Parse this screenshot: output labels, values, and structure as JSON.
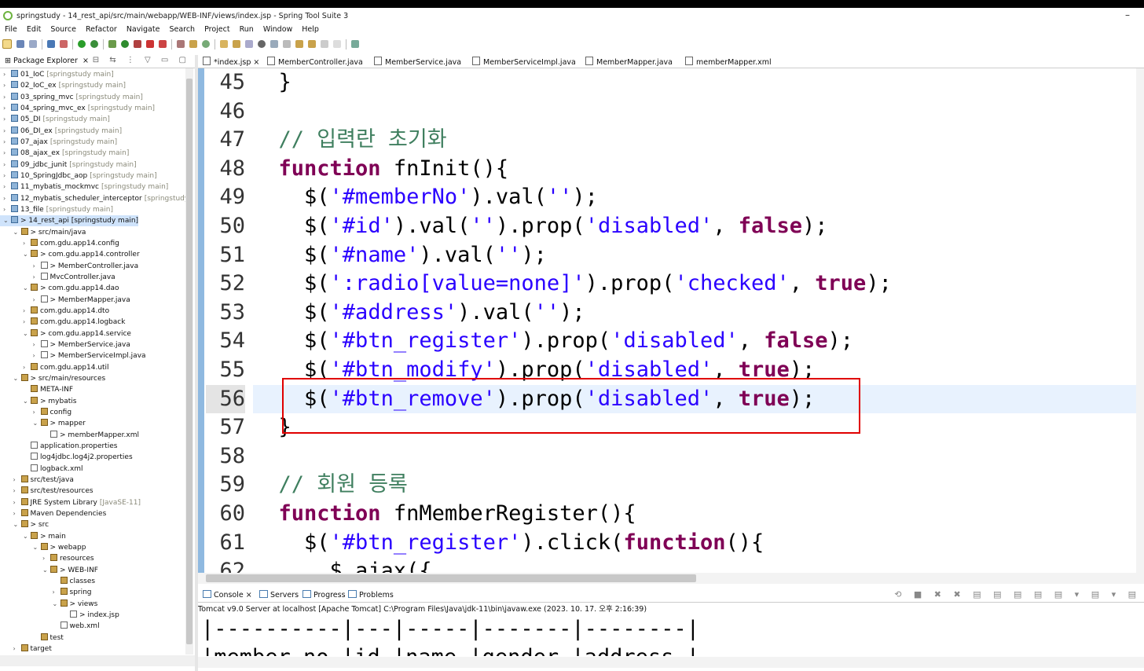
{
  "window": {
    "title": "springstudy - 14_rest_api/src/main/webapp/WEB-INF/views/index.jsp - Spring Tool Suite 3",
    "minimize": "–"
  },
  "menu": [
    "File",
    "Edit",
    "Source",
    "Refactor",
    "Navigate",
    "Search",
    "Project",
    "Run",
    "Window",
    "Help"
  ],
  "package_explorer": {
    "tab_label": "Package Explorer",
    "tab_close": "×",
    "tools": "⊟ ⇆ ⋮ ▽ ▭ ▢",
    "rows": [
      {
        "tw": "›",
        "icon": "proj",
        "label": "01_IoC",
        "meta": "[springstudy main]"
      },
      {
        "tw": "›",
        "icon": "proj",
        "label": "02_IoC_ex",
        "meta": "[springstudy main]"
      },
      {
        "tw": "›",
        "icon": "proj",
        "label": "03_spring_mvc",
        "meta": "[springstudy main]"
      },
      {
        "tw": "›",
        "icon": "proj",
        "label": "04_spring_mvc_ex",
        "meta": "[springstudy main]"
      },
      {
        "tw": "›",
        "icon": "proj",
        "label": "05_DI",
        "meta": "[springstudy main]"
      },
      {
        "tw": "›",
        "icon": "proj",
        "label": "06_DI_ex",
        "meta": "[springstudy main]"
      },
      {
        "tw": "›",
        "icon": "proj",
        "label": "07_ajax",
        "meta": "[springstudy main]"
      },
      {
        "tw": "›",
        "icon": "proj",
        "label": "08_ajax_ex",
        "meta": "[springstudy main]"
      },
      {
        "tw": "›",
        "icon": "proj",
        "label": "09_jdbc_junit",
        "meta": "[springstudy main]"
      },
      {
        "tw": "›",
        "icon": "proj",
        "label": "10_SpringJdbc_aop",
        "meta": "[springstudy main]"
      },
      {
        "tw": "›",
        "icon": "proj",
        "label": "11_mybatis_mockmvc",
        "meta": "[springstudy main]"
      },
      {
        "tw": "›",
        "icon": "proj",
        "label": "12_mybatis_scheduler_interceptor",
        "meta": "[springstudy"
      },
      {
        "tw": "›",
        "icon": "proj",
        "label": "13_file",
        "meta": "[springstudy main]"
      },
      {
        "tw": "⌄",
        "icon": "proj",
        "label": "> 14_rest_api [springstudy main]",
        "meta": "",
        "sel": true
      },
      {
        "tw": "⌄",
        "icon": "pkg",
        "label": "> src/main/java",
        "meta": "",
        "indent": 1
      },
      {
        "tw": "›",
        "icon": "pkg",
        "label": "com.gdu.app14.config",
        "meta": "",
        "indent": 2
      },
      {
        "tw": "⌄",
        "icon": "pkg",
        "label": "> com.gdu.app14.controller",
        "meta": "",
        "indent": 2
      },
      {
        "tw": "›",
        "icon": "file",
        "label": "> MemberController.java",
        "meta": "",
        "indent": 3
      },
      {
        "tw": "›",
        "icon": "file",
        "label": "MvcController.java",
        "meta": "",
        "indent": 3
      },
      {
        "tw": "⌄",
        "icon": "pkg",
        "label": "> com.gdu.app14.dao",
        "meta": "",
        "indent": 2
      },
      {
        "tw": "›",
        "icon": "file",
        "label": "> MemberMapper.java",
        "meta": "",
        "indent": 3
      },
      {
        "tw": "›",
        "icon": "pkg",
        "label": "com.gdu.app14.dto",
        "meta": "",
        "indent": 2
      },
      {
        "tw": "›",
        "icon": "pkg",
        "label": "com.gdu.app14.logback",
        "meta": "",
        "indent": 2
      },
      {
        "tw": "⌄",
        "icon": "pkg",
        "label": "> com.gdu.app14.service",
        "meta": "",
        "indent": 2
      },
      {
        "tw": "›",
        "icon": "file",
        "label": "> MemberService.java",
        "meta": "",
        "indent": 3
      },
      {
        "tw": "›",
        "icon": "file",
        "label": "> MemberServiceImpl.java",
        "meta": "",
        "indent": 3
      },
      {
        "tw": "›",
        "icon": "pkg",
        "label": "com.gdu.app14.util",
        "meta": "",
        "indent": 2
      },
      {
        "tw": "⌄",
        "icon": "pkg",
        "label": "> src/main/resources",
        "meta": "",
        "indent": 1
      },
      {
        "tw": "",
        "icon": "pkg",
        "label": "META-INF",
        "meta": "",
        "indent": 2
      },
      {
        "tw": "⌄",
        "icon": "pkg",
        "label": "> mybatis",
        "meta": "",
        "indent": 2
      },
      {
        "tw": "›",
        "icon": "pkg",
        "label": "config",
        "meta": "",
        "indent": 3
      },
      {
        "tw": "⌄",
        "icon": "pkg",
        "label": "> mapper",
        "meta": "",
        "indent": 3
      },
      {
        "tw": "",
        "icon": "file",
        "label": "> memberMapper.xml",
        "meta": "",
        "indent": 4
      },
      {
        "tw": "",
        "icon": "file",
        "label": "application.properties",
        "meta": "",
        "indent": 2
      },
      {
        "tw": "",
        "icon": "file",
        "label": "log4jdbc.log4j2.properties",
        "meta": "",
        "indent": 2
      },
      {
        "tw": "",
        "icon": "file",
        "label": "logback.xml",
        "meta": "",
        "indent": 2
      },
      {
        "tw": "›",
        "icon": "pkg",
        "label": "src/test/java",
        "meta": "",
        "indent": 1
      },
      {
        "tw": "›",
        "icon": "pkg",
        "label": "src/test/resources",
        "meta": "",
        "indent": 1
      },
      {
        "tw": "›",
        "icon": "pkg",
        "label": "JRE System Library",
        "meta": "[JavaSE-11]",
        "indent": 1
      },
      {
        "tw": "›",
        "icon": "pkg",
        "label": "Maven Dependencies",
        "meta": "",
        "indent": 1
      },
      {
        "tw": "⌄",
        "icon": "pkg",
        "label": "> src",
        "meta": "",
        "indent": 1
      },
      {
        "tw": "⌄",
        "icon": "pkg",
        "label": "> main",
        "meta": "",
        "indent": 2
      },
      {
        "tw": "⌄",
        "icon": "pkg",
        "label": "> webapp",
        "meta": "",
        "indent": 3
      },
      {
        "tw": "›",
        "icon": "pkg",
        "label": "resources",
        "meta": "",
        "indent": 4
      },
      {
        "tw": "⌄",
        "icon": "pkg",
        "label": "> WEB-INF",
        "meta": "",
        "indent": 4
      },
      {
        "tw": "",
        "icon": "pkg",
        "label": "classes",
        "meta": "",
        "indent": 5
      },
      {
        "tw": "›",
        "icon": "pkg",
        "label": "spring",
        "meta": "",
        "indent": 5
      },
      {
        "tw": "⌄",
        "icon": "pkg",
        "label": "> views",
        "meta": "",
        "indent": 5
      },
      {
        "tw": "",
        "icon": "file",
        "label": "> index.jsp",
        "meta": "",
        "indent": 6
      },
      {
        "tw": "",
        "icon": "file",
        "label": "web.xml",
        "meta": "",
        "indent": 5
      },
      {
        "tw": "",
        "icon": "pkg",
        "label": "test",
        "meta": "",
        "indent": 3
      },
      {
        "tw": "›",
        "icon": "pkg",
        "label": "target",
        "meta": "",
        "indent": 1
      }
    ]
  },
  "editor": {
    "tabs": [
      {
        "label": "*index.jsp",
        "close": "×",
        "active": true
      },
      {
        "label": "MemberController.java"
      },
      {
        "label": "MemberService.java"
      },
      {
        "label": "MemberServiceImpl.java"
      },
      {
        "label": "MemberMapper.java"
      },
      {
        "label": "memberMapper.xml"
      }
    ],
    "current_line": 56,
    "lines": [
      {
        "n": "45",
        "code": "  }"
      },
      {
        "n": "46",
        "code": ""
      },
      {
        "n": "47",
        "code": "  // 입력란 초기화"
      },
      {
        "n": "48",
        "code": "  function fnInit(){"
      },
      {
        "n": "49",
        "code": "    $('#memberNo').val('');"
      },
      {
        "n": "50",
        "code": "    $('#id').val('').prop('disabled', false);"
      },
      {
        "n": "51",
        "code": "    $('#name').val('');"
      },
      {
        "n": "52",
        "code": "    $(':radio[value=none]').prop('checked', true);"
      },
      {
        "n": "53",
        "code": "    $('#address').val('');"
      },
      {
        "n": "54",
        "code": "    $('#btn_register').prop('disabled', false);"
      },
      {
        "n": "55",
        "code": "    $('#btn_modify').prop('disabled', true);"
      },
      {
        "n": "56",
        "code": "    $('#btn_remove').prop('disabled', true);"
      },
      {
        "n": "57",
        "code": "  }"
      },
      {
        "n": "58",
        "code": ""
      },
      {
        "n": "59",
        "code": "  // 회원 등록"
      },
      {
        "n": "60",
        "code": "  function fnMemberRegister(){"
      },
      {
        "n": "61",
        "code": "    $('#btn_register').click(function(){"
      },
      {
        "n": "62",
        "code": "      $.ajax({"
      }
    ]
  },
  "console": {
    "tabs": [
      {
        "label": "Console",
        "close": "×",
        "active": true
      },
      {
        "label": "Servers"
      },
      {
        "label": "Progress"
      },
      {
        "label": "Problems"
      }
    ],
    "tools": "⟲ ■ ✖ ✖ ▤ ▤ ▤ ▤ ▤ ▾ ▤ ▾ ▤",
    "status": "Tomcat v9.0 Server at localhost [Apache Tomcat] C:\\Program Files\\Java\\jdk-11\\bin\\javaw.exe  (2023. 10. 17. 오후 2:16:39)",
    "output": [
      "|----------|---|-----|-------|--------|",
      "|member_no |id |name |gender |address |"
    ]
  },
  "colors": {
    "keyword": "#7f0055",
    "string": "#2a00ff",
    "comment": "#3f7f5f",
    "highlight_box": "#e00000"
  }
}
